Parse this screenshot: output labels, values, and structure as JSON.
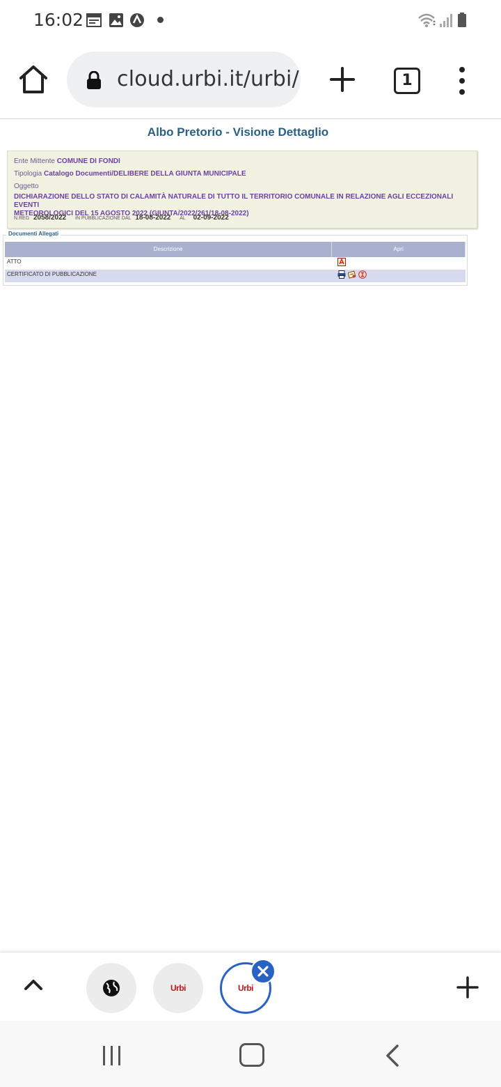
{
  "status_bar": {
    "time": "16:02",
    "icons": [
      "calendar-icon",
      "image-icon",
      "vpn-icon",
      "dot-icon",
      "wifi-icon",
      "signal-icon",
      "battery-icon"
    ]
  },
  "browser": {
    "url": "cloud.urbi.it/urbi/",
    "tab_count": "1",
    "icons": [
      "home-icon",
      "lock-icon",
      "plus-icon",
      "tabs-icon",
      "more-vertical-icon"
    ]
  },
  "page": {
    "title": "Albo Pretorio - Visione Dettaglio",
    "detail": {
      "ente_label": "Ente Mittente",
      "ente_value": "COMUNE DI FONDI",
      "tipologia_label": "Tipologia",
      "tipologia_value": "Catalogo Documenti/DELIBERE DELLA GIUNTA MUNICIPALE",
      "oggetto_label": "Oggetto",
      "oggetto_line1": "DICHIARAZIONE DELLO STATO DI CALAMITÀ NATURALE DI TUTTO IL TERRITORIO COMUNALE IN RELAZIONE AGLI ECCEZIONALI EVENTI",
      "oggetto_line2": "METEOROLOGICI DEL 15 AGOSTO 2022 (GIUNTA/2022/261/18-08-2022)",
      "nreg_label": "N.REG",
      "nreg_value": "2058/2022",
      "pub_label": "IN PUBBLICAZIONE DAL",
      "pub_value": "18-08-2022",
      "al_label": "AL",
      "al_value": "02-09-2022"
    },
    "attachments": {
      "legend": "Documenti Allegati",
      "columns": [
        "Descrizione",
        "Apri"
      ],
      "rows": [
        {
          "description": "ATTO",
          "icons": [
            "pdf-icon"
          ]
        },
        {
          "description": "CERTIFICATO DI PUBBLICAZIONE",
          "icons": [
            "print-icon",
            "certificate-icon",
            "stamp-icon"
          ]
        }
      ]
    }
  },
  "bottom_tabs": {
    "tab1_icon": "globe-icon",
    "tab2_logo": "Urbi",
    "tab3_logo": "Urbi",
    "icons": [
      "chevron-up-icon",
      "close-icon",
      "plus-icon"
    ]
  },
  "nav_bar": {
    "icons": [
      "recent-apps-icon",
      "home-nav-icon",
      "back-icon"
    ]
  },
  "colors": {
    "title": "#2a5f86",
    "value_purple": "#6d3fa6",
    "detail_bg": "#f1f2e2",
    "table_header": "#a9b1cf",
    "table_alt_row": "#d7d9ef",
    "active_tab": "#2a62c4",
    "urbi_red": "#c3151b"
  }
}
